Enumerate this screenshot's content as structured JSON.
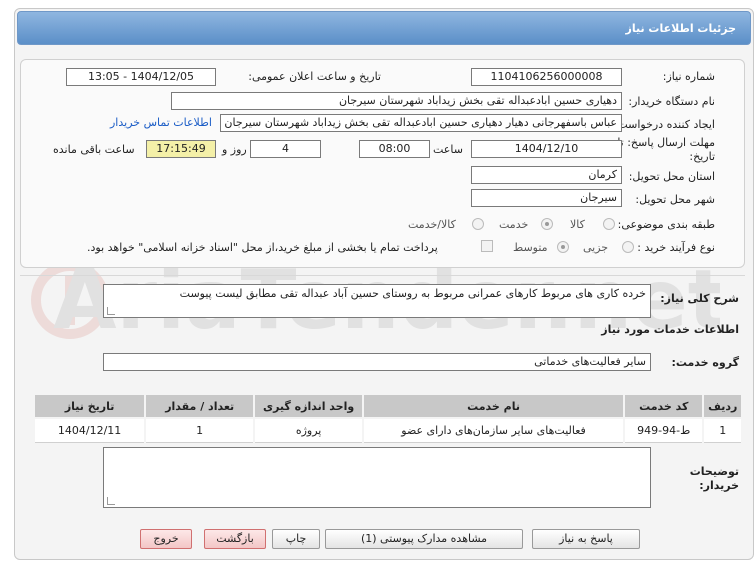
{
  "title": "جزئیات اطلاعات نیاز",
  "need_number": {
    "label": "شماره نیاز:",
    "value": "1104106256000008"
  },
  "announce": {
    "label": "تاریخ و ساعت اعلان عمومی:",
    "value": "1404/12/05 - 13:05"
  },
  "buyer_org": {
    "label": "نام دستگاه خریدار:",
    "value": "دهیاری حسین ابادعبداله تقی بخش زیداباد شهرستان سیرجان"
  },
  "requester": {
    "label": "ایجاد کننده درخواست:",
    "value": "عباس باسفهرجانی دهیار  دهیاری حسین ابادعبداله تقی بخش زیداباد شهرستان سیرجان",
    "contact_link": "اطلاعات تماس خریدار"
  },
  "deadline": {
    "label_line1": "مهلت ارسال پاسخ: تا",
    "label_line2": "تاریخ:",
    "date": "1404/12/10",
    "time_label": "ساعت",
    "time": "08:00",
    "days": "4",
    "days_label": "روز و",
    "remaining": "17:15:49",
    "remaining_label": "ساعت باقی مانده"
  },
  "province": {
    "label": "استان محل تحویل:",
    "value": "کرمان"
  },
  "city": {
    "label": "شهر محل تحویل:",
    "value": "سیرجان"
  },
  "category": {
    "label": "طبقه بندی موضوعی:",
    "options": [
      "کالا",
      "خدمت",
      "کالا/خدمت"
    ],
    "selected": "خدمت"
  },
  "process": {
    "label": "نوع فرآیند خرید :",
    "options": [
      "جزیی",
      "متوسط"
    ],
    "selected": "متوسط",
    "note": "پرداخت تمام یا بخشی از مبلغ خرید،از محل \"اسناد خزانه اسلامی\" خواهد بود."
  },
  "description": {
    "label": "شرح کلی نیاز:",
    "value": "خرده کاری های  مربوط کارهای عمرانی مربوط به روستای حسین آباد عبداله تقی   مطابق لیست پیوست"
  },
  "services_heading": "اطلاعات خدمات مورد نیاز",
  "service_group": {
    "label": "گروه خدمت:",
    "value": "سایر فعالیت‌های خدماتی"
  },
  "table": {
    "headers": [
      "ردیف",
      "کد خدمت",
      "نام خدمت",
      "واحد اندازه گیری",
      "تعداد / مقدار",
      "تاریخ نیاز"
    ],
    "rows": [
      [
        "1",
        "ط-94-949",
        "فعالیت‌های سایر سازمان‌های دارای عضو",
        "پروژه",
        "1",
        "1404/12/11"
      ]
    ]
  },
  "buyer_notes": {
    "label_line1": "توضیحات",
    "label_line2": "خریدار:",
    "value": ""
  },
  "buttons": {
    "reply": "پاسخ به نیاز",
    "attachments": "مشاهده مدارک پیوستی (1)",
    "print": "چاپ",
    "back": "بازگشت",
    "exit": "خروج"
  },
  "watermark": "AriaTender.net"
}
